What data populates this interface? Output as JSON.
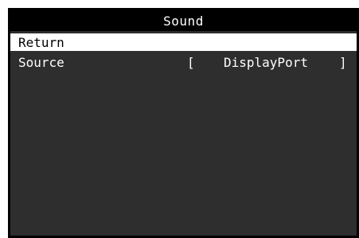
{
  "menu": {
    "title": "Sound",
    "items": [
      {
        "label": "Return",
        "selected": true
      },
      {
        "label": "Source",
        "value": "DisplayPort",
        "bracket_open": "[",
        "bracket_close": "]"
      }
    ]
  },
  "colors": {
    "panel_bg": "#2e2e2e",
    "title_bg": "#000000",
    "highlight_bg": "#ffffff",
    "text": "#ffffff",
    "highlight_text": "#000000"
  }
}
